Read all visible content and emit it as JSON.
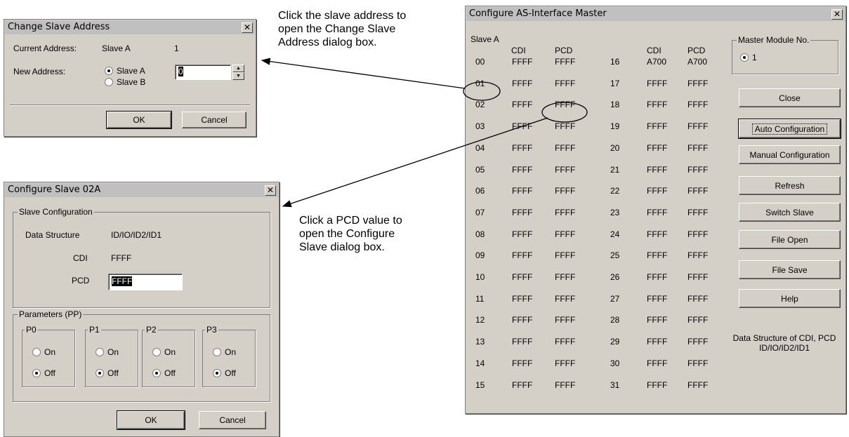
{
  "change_slave": {
    "title": "Change Slave Address",
    "current_label": "Current Address:",
    "current_slave": "Slave A",
    "current_number": "1",
    "new_label": "New Address:",
    "option_a": "Slave A",
    "option_b": "Slave B",
    "address_value": "0",
    "ok": "OK",
    "cancel": "Cancel"
  },
  "configure_slave": {
    "title": "Configure Slave 02A",
    "group_config": "Slave Configuration",
    "ds_label": "Data Structure",
    "ds_value": "ID/IO/ID2/ID1",
    "cdi_label": "CDI",
    "cdi_value": "FFFF",
    "pcd_label": "PCD",
    "pcd_value": "FFFF",
    "group_params": "Parameters (PP)",
    "params": [
      {
        "label": "P0",
        "on": "On",
        "off": "Off"
      },
      {
        "label": "P1",
        "on": "On",
        "off": "Off"
      },
      {
        "label": "P2",
        "on": "On",
        "off": "Off"
      },
      {
        "label": "P3",
        "on": "On",
        "off": "Off"
      }
    ],
    "ok": "OK",
    "cancel": "Cancel"
  },
  "annotations": {
    "top": [
      "Click the slave address to",
      "open the Change Slave",
      "Address dialog box."
    ],
    "middle": [
      "Click a PCD value to",
      "open the Configure",
      "Slave dialog box."
    ]
  },
  "master": {
    "title": "Configure AS-Interface Master",
    "slave_label": "Slave A",
    "col_cdi": "CDI",
    "col_pcd": "PCD",
    "left_rows": [
      {
        "addr": "00",
        "cdi": "FFFF",
        "pcd": "FFFF"
      },
      {
        "addr": "01",
        "cdi": "FFFF",
        "pcd": "FFFF"
      },
      {
        "addr": "02",
        "cdi": "FFFF",
        "pcd": "FFFF"
      },
      {
        "addr": "03",
        "cdi": "FFFF",
        "pcd": "FFFF"
      },
      {
        "addr": "04",
        "cdi": "FFFF",
        "pcd": "FFFF"
      },
      {
        "addr": "05",
        "cdi": "FFFF",
        "pcd": "FFFF"
      },
      {
        "addr": "06",
        "cdi": "FFFF",
        "pcd": "FFFF"
      },
      {
        "addr": "07",
        "cdi": "FFFF",
        "pcd": "FFFF"
      },
      {
        "addr": "08",
        "cdi": "FFFF",
        "pcd": "FFFF"
      },
      {
        "addr": "09",
        "cdi": "FFFF",
        "pcd": "FFFF"
      },
      {
        "addr": "10",
        "cdi": "FFFF",
        "pcd": "FFFF"
      },
      {
        "addr": "11",
        "cdi": "FFFF",
        "pcd": "FFFF"
      },
      {
        "addr": "12",
        "cdi": "FFFF",
        "pcd": "FFFF"
      },
      {
        "addr": "13",
        "cdi": "FFFF",
        "pcd": "FFFF"
      },
      {
        "addr": "14",
        "cdi": "FFFF",
        "pcd": "FFFF"
      },
      {
        "addr": "15",
        "cdi": "FFFF",
        "pcd": "FFFF"
      }
    ],
    "right_rows": [
      {
        "addr": "16",
        "cdi": "A700",
        "pcd": "A700"
      },
      {
        "addr": "17",
        "cdi": "FFFF",
        "pcd": "FFFF"
      },
      {
        "addr": "18",
        "cdi": "FFFF",
        "pcd": "FFFF"
      },
      {
        "addr": "19",
        "cdi": "FFFF",
        "pcd": "FFFF"
      },
      {
        "addr": "20",
        "cdi": "FFFF",
        "pcd": "FFFF"
      },
      {
        "addr": "21",
        "cdi": "FFFF",
        "pcd": "FFFF"
      },
      {
        "addr": "22",
        "cdi": "FFFF",
        "pcd": "FFFF"
      },
      {
        "addr": "23",
        "cdi": "FFFF",
        "pcd": "FFFF"
      },
      {
        "addr": "24",
        "cdi": "FFFF",
        "pcd": "FFFF"
      },
      {
        "addr": "25",
        "cdi": "FFFF",
        "pcd": "FFFF"
      },
      {
        "addr": "26",
        "cdi": "FFFF",
        "pcd": "FFFF"
      },
      {
        "addr": "27",
        "cdi": "FFFF",
        "pcd": "FFFF"
      },
      {
        "addr": "28",
        "cdi": "FFFF",
        "pcd": "FFFF"
      },
      {
        "addr": "29",
        "cdi": "FFFF",
        "pcd": "FFFF"
      },
      {
        "addr": "30",
        "cdi": "FFFF",
        "pcd": "FFFF"
      },
      {
        "addr": "31",
        "cdi": "FFFF",
        "pcd": "FFFF"
      }
    ],
    "master_group_label": "Master Module No.",
    "master_module_value": "1",
    "buttons": {
      "close": "Close",
      "auto": "Auto Configuration",
      "manual": "Manual Configuration",
      "refresh": "Refresh",
      "switch": "Switch Slave",
      "open": "File Open",
      "save": "File Save",
      "help": "Help"
    },
    "ds_note_1": "Data Structure of CDI, PCD",
    "ds_note_2": "ID/IO/ID2/ID1"
  }
}
